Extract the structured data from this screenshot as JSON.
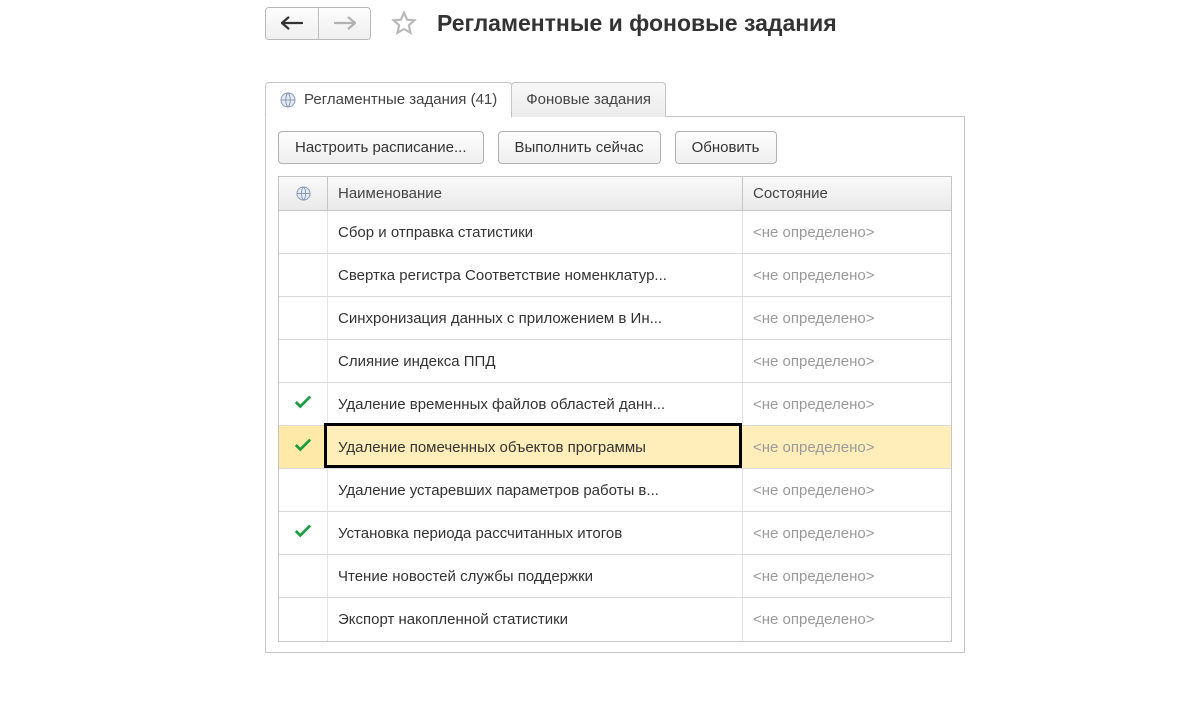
{
  "title": "Регламентные и фоновые задания",
  "tabs": {
    "scheduled": {
      "label": "Регламентные задания (41)",
      "active": true
    },
    "background": {
      "label": "Фоновые задания",
      "active": false
    }
  },
  "toolbar": {
    "configure_schedule": "Настроить расписание...",
    "run_now": "Выполнить сейчас",
    "refresh": "Обновить"
  },
  "columns": {
    "name": "Наименование",
    "state": "Состояние"
  },
  "state_undefined": "<не определено>",
  "rows": [
    {
      "checked": false,
      "name": "Сбор и отправка статистики",
      "state_key": "state_undefined",
      "selected": false
    },
    {
      "checked": false,
      "name": "Свертка регистра Соответствие номенклатур...",
      "state_key": "state_undefined",
      "selected": false
    },
    {
      "checked": false,
      "name": "Синхронизация данных с приложением в Ин...",
      "state_key": "state_undefined",
      "selected": false
    },
    {
      "checked": false,
      "name": "Слияние индекса ППД",
      "state_key": "state_undefined",
      "selected": false
    },
    {
      "checked": true,
      "name": "Удаление временных файлов областей данн...",
      "state_key": "state_undefined",
      "selected": false
    },
    {
      "checked": true,
      "name": "Удаление помеченных объектов программы",
      "state_key": "state_undefined",
      "selected": true
    },
    {
      "checked": false,
      "name": "Удаление устаревших параметров работы в...",
      "state_key": "state_undefined",
      "selected": false
    },
    {
      "checked": true,
      "name": "Установка периода рассчитанных итогов",
      "state_key": "state_undefined",
      "selected": false
    },
    {
      "checked": false,
      "name": "Чтение новостей службы поддержки",
      "state_key": "state_undefined",
      "selected": false
    },
    {
      "checked": false,
      "name": "Экспорт накопленной статистики",
      "state_key": "state_undefined",
      "selected": false
    }
  ]
}
